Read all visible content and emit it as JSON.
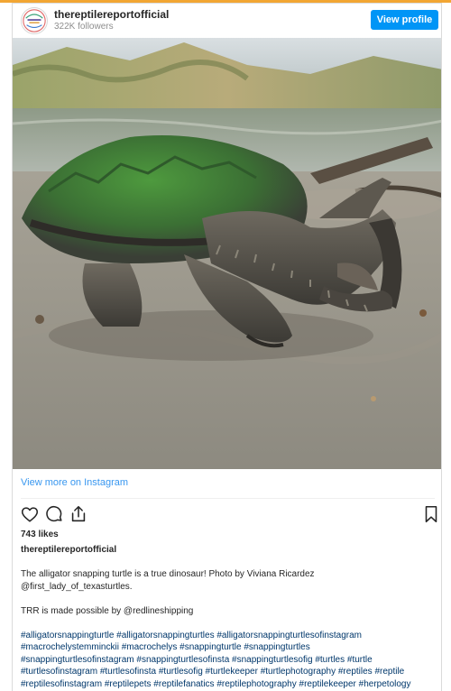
{
  "account": {
    "username": "thereptilereportofficial",
    "followers": "322K followers",
    "avatar_logo_text": "THE REPTILE REPORT"
  },
  "header": {
    "view_profile_label": "View profile",
    "accent_color": "#0095f6"
  },
  "post": {
    "view_more_label": "View more on Instagram",
    "likes": "743 likes",
    "caption_username": "thereptilereportofficial",
    "caption_line1": "The alligator snapping turtle is a true dinosaur! Photo by Viviana Ricardez",
    "caption_line2": "@first_lady_of_texasturtles.",
    "sponsor_line": "TRR is made possible by @redlineshipping",
    "hashtags": [
      "#alligatorsnappingturtle #alligatorsnappingturtles #alligatorsnappingturtlesofinstagram",
      "#macrochelystemminckii #macrochelys #snappingturtle #snappingturtles",
      "#snappingturtlesofinstagram #snappingturtlesofinsta #snappingturtlesofig #turtles #turtle",
      "#turtlesofinstagram #turtlesofinsta #turtlesofig #turtlekeeper #turtlephotography #reptiles #reptile",
      "#reptilesofinstagram #reptilepets #reptilefanatics #reptilephotography #reptilekeeper #herpetology"
    ]
  },
  "icons": {
    "like": "heart-icon",
    "comment": "comment-icon",
    "share": "share-icon",
    "save": "bookmark-icon"
  }
}
